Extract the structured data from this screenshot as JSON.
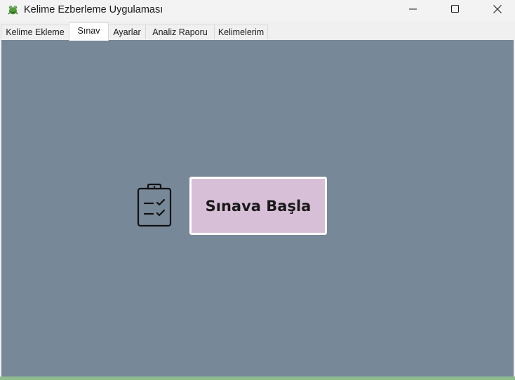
{
  "window": {
    "title": "Kelime Ezberleme Uygulaması",
    "app_icon": "frog-icon"
  },
  "controls": {
    "minimize_icon": "minimize-icon",
    "maximize_icon": "maximize-icon",
    "close_icon": "close-icon"
  },
  "tabs": [
    {
      "label": "Kelime Ekleme",
      "active": false
    },
    {
      "label": "Sınav",
      "active": true
    },
    {
      "label": "Ayarlar",
      "active": false
    },
    {
      "label": "Analiz Raporu",
      "active": false
    },
    {
      "label": "Kelimelerim",
      "active": false
    }
  ],
  "exam_panel": {
    "icon": "clipboard-checklist-icon",
    "start_button_label": "Sınava Başla"
  },
  "colors": {
    "panel_background": "#778899",
    "button_background": "#d8bfd8",
    "button_border": "#ffffff",
    "bottom_bar": "#8fbc8f"
  }
}
